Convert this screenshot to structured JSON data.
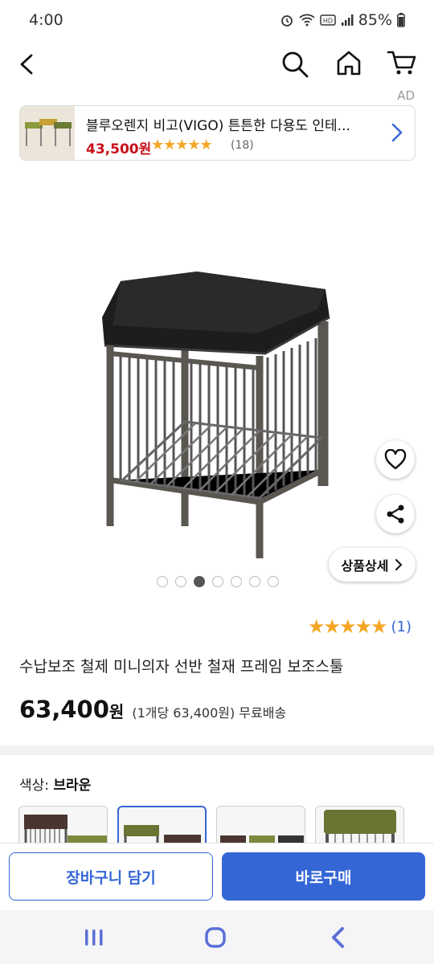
{
  "status": {
    "time": "4:00",
    "battery": "85%"
  },
  "header": {
    "icons": [
      "back-icon",
      "search-icon",
      "home-icon",
      "cart-icon"
    ]
  },
  "ad": {
    "label": "AD",
    "title": "블루오렌지 비고(VIGO) 튼튼한 다용도 인테...",
    "price": "43,500원",
    "stars": "★★★★★",
    "review_count": "(18)"
  },
  "gallery": {
    "dot_count": 7,
    "active_index": 2
  },
  "actions": {
    "detail_label": "상품상세"
  },
  "product": {
    "stars": "★★★★★",
    "rating_count": "(1)",
    "title": "수납보조 철제 미니의자 선반 철재 프레임 보조스툴",
    "price": "63,400",
    "price_unit": "원",
    "price_note": "(1개당 63,400원) 무료배송",
    "color_label": "색상: ",
    "color_value": "브라운"
  },
  "swatches": [
    "brown",
    "green-selected",
    "mixed",
    "green"
  ],
  "bottom": {
    "cart_label": "장바구니 담기",
    "buy_label": "바로구매"
  },
  "colors": {
    "accent": "#3466d6",
    "price_red": "#c8101a",
    "star": "#f5a623"
  }
}
